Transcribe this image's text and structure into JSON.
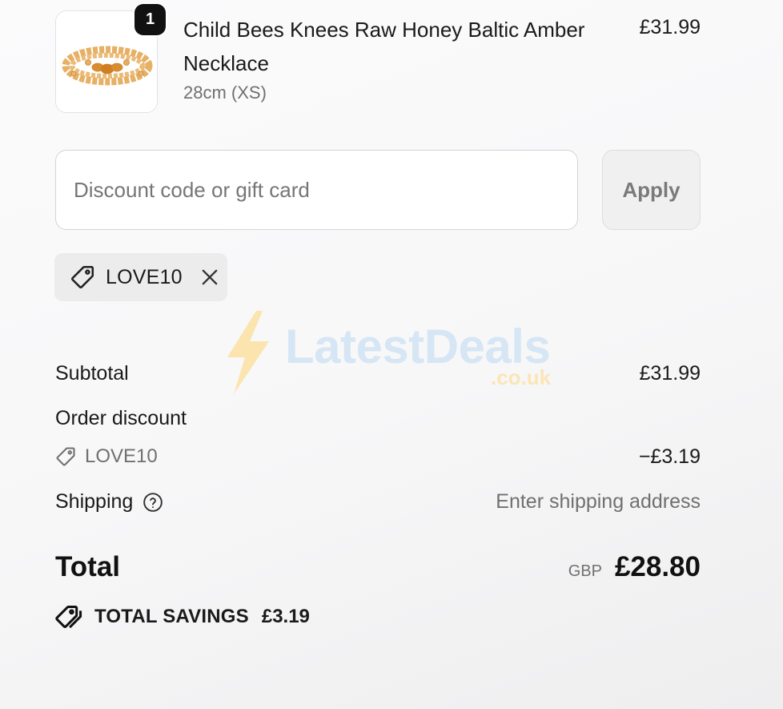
{
  "product": {
    "name": "Child Bees Knees Raw Honey Baltic Amber Necklace",
    "variant": "28cm (XS)",
    "price": "£31.99",
    "quantity": "1"
  },
  "discount": {
    "placeholder": "Discount code or gift card",
    "value": "",
    "apply_label": "Apply",
    "applied_code": "LOVE10"
  },
  "watermark": {
    "text": "LatestDeals",
    "sub": ".co.uk"
  },
  "summary": {
    "subtotal_label": "Subtotal",
    "subtotal_value": "£31.99",
    "order_discount_label": "Order discount",
    "discount_code": "LOVE10",
    "discount_value": "−£3.19",
    "shipping_label": "Shipping",
    "shipping_value": "Enter shipping address",
    "total_label": "Total",
    "currency": "GBP",
    "total_value": "£28.80",
    "savings_label": "TOTAL SAVINGS",
    "savings_value": "£3.19"
  },
  "colors": {
    "text": "#1a1a1a",
    "muted": "#707070",
    "badge": "#111111",
    "chip_bg": "#ececec",
    "amber": "#e3a246"
  },
  "icons": {
    "tag": "tag-icon",
    "close": "close-icon",
    "help": "help-circle-icon",
    "savings": "savings-tag-icon"
  }
}
